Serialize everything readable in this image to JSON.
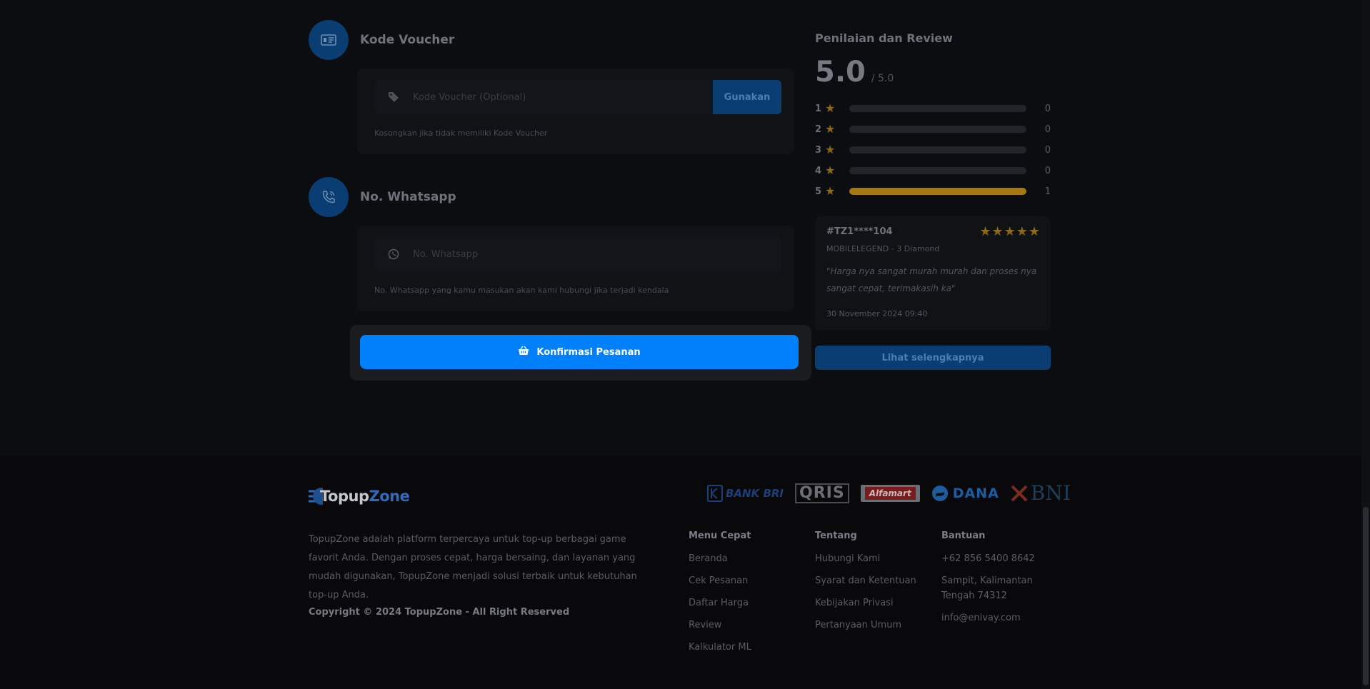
{
  "voucher": {
    "title": "Kode Voucher",
    "placeholder": "Kode Voucher (Optional)",
    "apply_label": "Gunakan",
    "hint": "Kosongkan jika tidak memiliki Kode Voucher"
  },
  "whatsapp": {
    "title": "No. Whatsapp",
    "placeholder": "No. Whatsapp",
    "hint": "No. Whatsapp yang kamu masukan akan kami hubungi jika terjadi kendala"
  },
  "confirm": {
    "label": "Konfirmasi Pesanan"
  },
  "reviews": {
    "title": "Penilaian dan Review",
    "score": "5.0",
    "score_max": "/ 5.0",
    "ratings": [
      {
        "stars": "1",
        "count": "0",
        "fraction": 0
      },
      {
        "stars": "2",
        "count": "0",
        "fraction": 0
      },
      {
        "stars": "3",
        "count": "0",
        "fraction": 0
      },
      {
        "stars": "4",
        "count": "0",
        "fraction": 0
      },
      {
        "stars": "5",
        "count": "1",
        "fraction": 1
      }
    ],
    "card": {
      "reviewer": "#TZ1****104",
      "rating": 5,
      "product": "MOBILELEGEND - 3 Diamond",
      "text": "\"Harga nya sangat murah murah dan proses nya sangat cepat, terimakasih ka\"",
      "date": "30 November 2024 09:40"
    },
    "more_label": "Lihat selengkapnya"
  },
  "footer": {
    "logo_part1": "Topup",
    "logo_part2": "Zone",
    "payments": [
      "BANK BRI",
      "QRIS",
      "Alfamart",
      "DANA",
      "BNI"
    ],
    "about": "TopupZone adalah platform terpercaya untuk top-up berbagai game favorit Anda. Dengan proses cepat, harga bersaing, dan layanan yang mudah digunakan, TopupZone menjadi solusi terbaik untuk kebutuhan top-up Anda.",
    "copyright": "Copyright © 2024 TopupZone - All Right Reserved",
    "menu": {
      "title": "Menu Cepat",
      "items": [
        "Beranda",
        "Cek Pesanan",
        "Daftar Harga",
        "Review",
        "Kalkulator ML"
      ]
    },
    "tentang": {
      "title": "Tentang",
      "items": [
        "Hubungi Kami",
        "Syarat dan Ketentuan",
        "Kebijakan Privasi",
        "Pertanyaan Umum"
      ]
    },
    "bantuan": {
      "title": "Bantuan",
      "items": [
        "+62 856 5400 8642",
        "Sampit, Kalimantan Tengah 74312",
        "info@enivay.com"
      ]
    }
  },
  "colors": {
    "accent": "#0080fb",
    "star": "#a47a10",
    "background": "#0c0d10"
  }
}
